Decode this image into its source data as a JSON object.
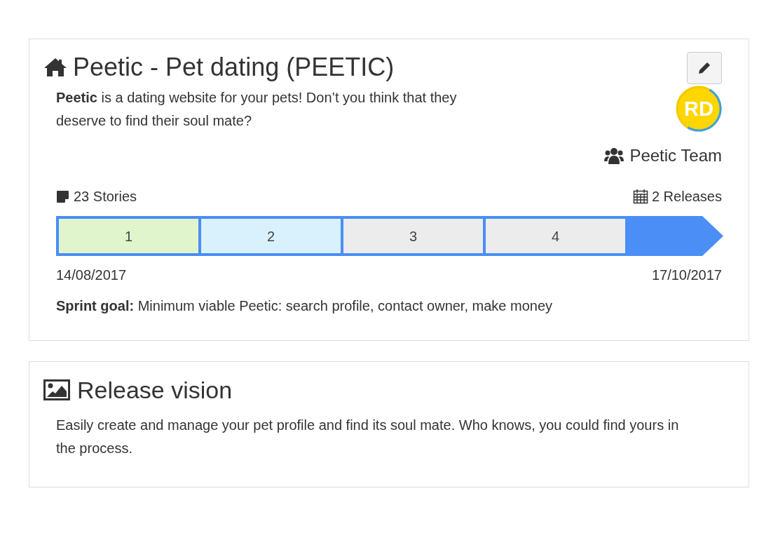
{
  "project": {
    "title": "Peetic - Pet dating (PEETIC)",
    "description": "**Peetic** is a dating website for your pets! Don’t you think that they deserve to find their soul mate?",
    "avatar": {
      "initials": "RD"
    },
    "team": "Peetic Team",
    "stories": "23 Stories",
    "releases": "2 Releases",
    "sprints": [
      {
        "label": "1",
        "color": "#e0f5cb"
      },
      {
        "label": "2",
        "color": "#d9f1fd"
      },
      {
        "label": "3",
        "color": "#ececec"
      },
      {
        "label": "4",
        "color": "#ececec"
      }
    ],
    "start_date": "14/08/2017",
    "end_date": "17/10/2017",
    "sprint_goal": "**Sprint goal:** Minimum viable Peetic: search profile, contact owner, make money"
  },
  "release_vision": {
    "title": "Release vision",
    "text": "Easily create and manage your pet profile and find its soul mate. Who knows, you could find yours in the process."
  }
}
